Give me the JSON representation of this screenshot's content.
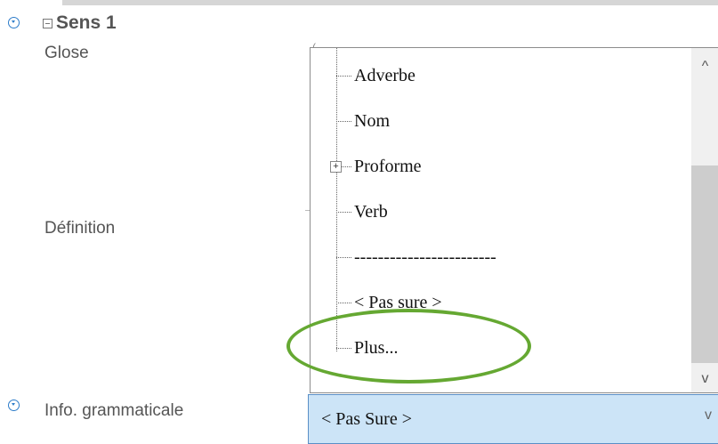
{
  "sense": {
    "title": "Sens 1"
  },
  "fields": {
    "glose_label": "Glose",
    "definition_label": "Définition",
    "grammatical_info_label": "Info. grammaticale",
    "glose_stub": "("
  },
  "dropdown": {
    "items": [
      {
        "label": "Adverbe",
        "expandable": false
      },
      {
        "label": "Nom",
        "expandable": false
      },
      {
        "label": "Proforme",
        "expandable": true
      },
      {
        "label": "Verb",
        "expandable": false
      },
      {
        "label": "------------------------",
        "expandable": false
      },
      {
        "label": "< Pas sure >",
        "expandable": false
      },
      {
        "label": "Plus...",
        "expandable": false
      }
    ],
    "scroll_up_glyph": "^",
    "scroll_down_glyph": "v",
    "expander_glyph": "+"
  },
  "combo": {
    "selected_value": "< Pas Sure >",
    "chevron_glyph": "v"
  },
  "colors": {
    "accent": "#2d7cc9",
    "highlight": "#65a832",
    "combo_bg": "#cce4f7"
  },
  "icons": {
    "expand": "chevron-down-circle-icon",
    "collapse": "minus-box-icon"
  }
}
